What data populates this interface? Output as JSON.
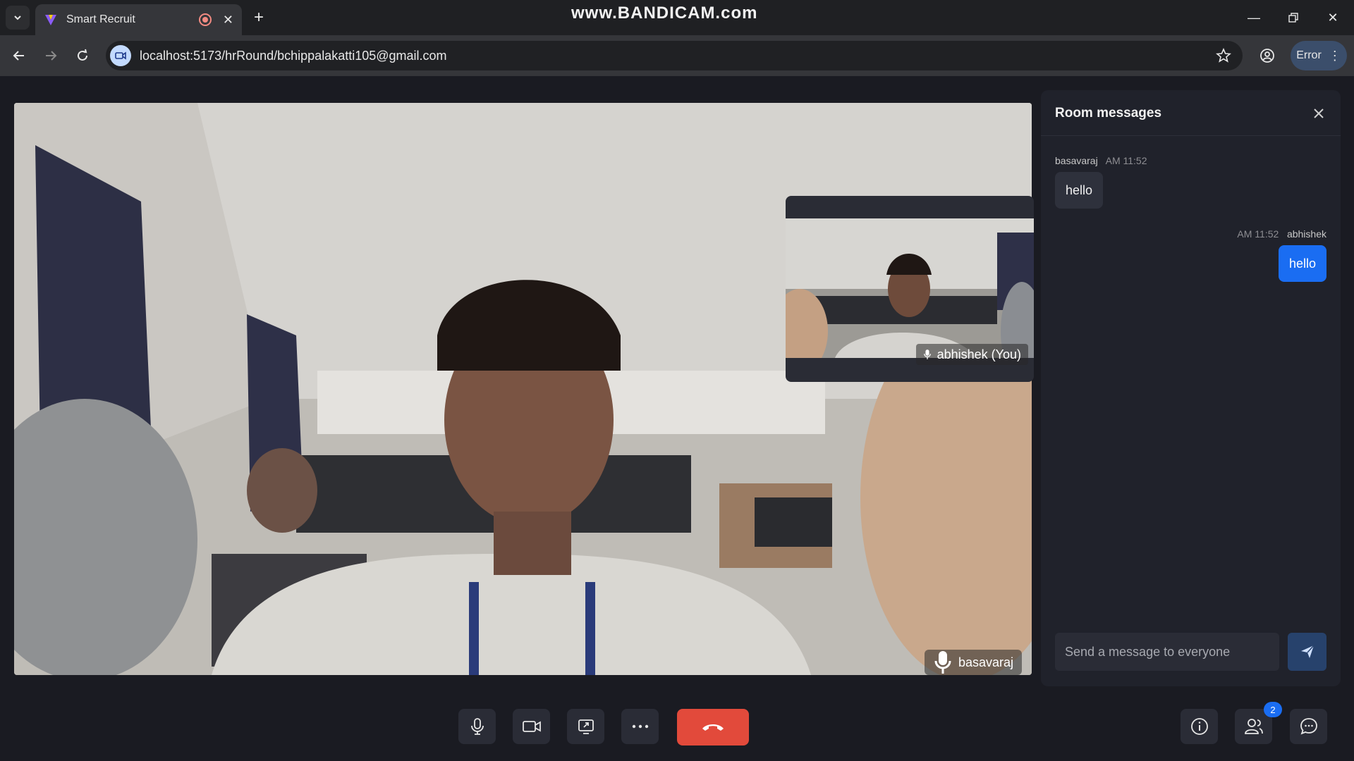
{
  "browser": {
    "tab_title": "Smart Recruit",
    "url": "localhost:5173/hrRound/bchippalakatti105@gmail.com",
    "watermark": "www.BANDICAM.com",
    "error_label": "Error"
  },
  "video": {
    "main_participant": "basavaraj",
    "self_participant": "abhishek (You)"
  },
  "chat": {
    "title": "Room messages",
    "messages": [
      {
        "sender": "basavaraj",
        "time": "AM 11:52",
        "text": "hello"
      },
      {
        "sender": "abhishek",
        "time": "AM 11:52",
        "text": "hello"
      }
    ],
    "input_placeholder": "Send a message to everyone"
  },
  "controls": {
    "participants_count": "2"
  },
  "colors": {
    "accent": "#1a6df2",
    "leave": "#e24a3b",
    "panel": "#20222b",
    "background": "#1a1b22"
  },
  "icons": [
    "tab-list-icon",
    "favicon-icon",
    "record-icon",
    "close-icon",
    "plus-icon",
    "minimize-icon",
    "restore-icon",
    "back-icon",
    "forward-icon",
    "reload-icon",
    "site-info-icon",
    "star-icon",
    "profile-icon",
    "kebab-icon",
    "mic-icon",
    "camera-icon",
    "screen-share-icon",
    "more-icon",
    "phone-hangup-icon",
    "info-icon",
    "people-icon",
    "chat-icon",
    "send-icon"
  ]
}
